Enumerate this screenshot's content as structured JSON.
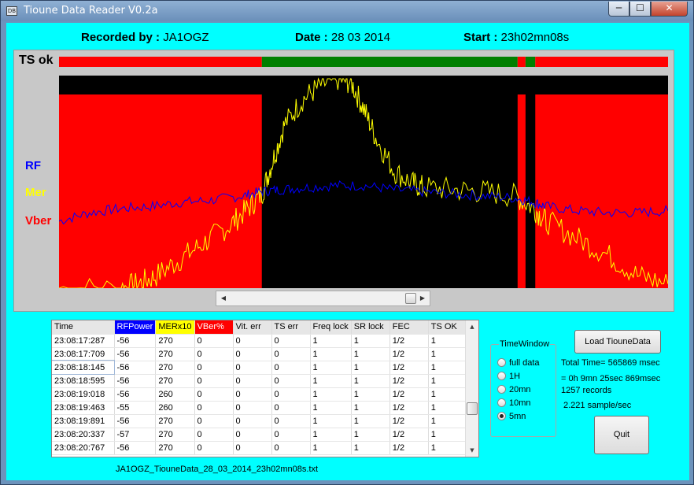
{
  "window": {
    "title": "Tioune Data Reader V0.2a",
    "min": "─",
    "max": "☐",
    "close": "✕",
    "app_icon": "DB"
  },
  "header": {
    "recorded_label": "Recorded by :",
    "recorded_value": "JA1OGZ",
    "date_label": "Date :",
    "date_value": "28 03 2014",
    "start_label": "Start :",
    "start_value": "23h02mn08s"
  },
  "chart": {
    "ts_label": "TS ok",
    "rf_label": "RF",
    "mer_label": "Mer",
    "vber_label": "Vber",
    "colors": {
      "rf": "#0000ff",
      "mer": "#ffff00",
      "vber": "#ff0000",
      "ts_ok": "#008000",
      "ts_bad": "#ff0000",
      "bg": "#000000"
    }
  },
  "chart_data": {
    "type": "line",
    "title": "",
    "x_range": [
      0,
      1
    ],
    "ts_segments": [
      [
        0,
        0.333,
        "bad"
      ],
      [
        0.333,
        0.753,
        "ok"
      ],
      [
        0.753,
        0.766,
        "bad"
      ],
      [
        0.766,
        0.782,
        "ok"
      ],
      [
        0.782,
        1.0,
        "bad"
      ]
    ],
    "vber_segments": [
      [
        0,
        0.333
      ],
      [
        0.753,
        0.766
      ],
      [
        0.782,
        1.0
      ]
    ],
    "series": [
      {
        "name": "RF",
        "x": [
          0,
          0.05,
          0.1,
          0.15,
          0.2,
          0.25,
          0.3,
          0.33,
          0.36,
          0.4,
          0.45,
          0.5,
          0.55,
          0.6,
          0.65,
          0.7,
          0.75,
          0.78,
          0.8,
          0.85,
          0.9,
          0.95,
          1.0
        ],
        "y": [
          0.32,
          0.36,
          0.38,
          0.39,
          0.41,
          0.42,
          0.44,
          0.46,
          0.47,
          0.48,
          0.49,
          0.49,
          0.47,
          0.46,
          0.45,
          0.44,
          0.43,
          0.41,
          0.39,
          0.37,
          0.36,
          0.36,
          0.37
        ]
      },
      {
        "name": "Mer",
        "x": [
          0,
          0.1,
          0.13,
          0.16,
          0.2,
          0.24,
          0.28,
          0.31,
          0.333,
          0.35,
          0.37,
          0.4,
          0.43,
          0.46,
          0.48,
          0.5,
          0.52,
          0.55,
          0.58,
          0.6,
          0.65,
          0.7,
          0.75,
          0.78,
          0.8,
          0.85,
          0.9,
          0.95,
          1.0
        ],
        "y": [
          0.0,
          0.0,
          0.02,
          0.06,
          0.14,
          0.22,
          0.3,
          0.38,
          0.45,
          0.6,
          0.78,
          0.9,
          0.97,
          1.0,
          0.98,
          0.86,
          0.72,
          0.56,
          0.5,
          0.48,
          0.47,
          0.46,
          0.44,
          0.38,
          0.32,
          0.24,
          0.16,
          0.06,
          0.02
        ]
      }
    ]
  },
  "grid": {
    "columns": [
      "Time",
      "RFPower",
      "MERx10",
      "VBer%",
      "Vit. err",
      "TS err",
      "Freq lock",
      "SR lock",
      "FEC",
      "TS OK"
    ],
    "rows": [
      [
        "23:08:17:287",
        "-56",
        "270",
        "0",
        "0",
        "0",
        "1",
        "1",
        "1/2",
        "1"
      ],
      [
        "23:08:17:709",
        "-56",
        "270",
        "0",
        "0",
        "0",
        "1",
        "1",
        "1/2",
        "1"
      ],
      [
        "23:08:18:145",
        "-56",
        "270",
        "0",
        "0",
        "0",
        "1",
        "1",
        "1/2",
        "1"
      ],
      [
        "23:08:18:595",
        "-56",
        "270",
        "0",
        "0",
        "0",
        "1",
        "1",
        "1/2",
        "1"
      ],
      [
        "23:08:19:018",
        "-56",
        "260",
        "0",
        "0",
        "0",
        "1",
        "1",
        "1/2",
        "1"
      ],
      [
        "23:08:19:463",
        "-55",
        "260",
        "0",
        "0",
        "0",
        "1",
        "1",
        "1/2",
        "1"
      ],
      [
        "23:08:19:891",
        "-56",
        "270",
        "0",
        "0",
        "0",
        "1",
        "1",
        "1/2",
        "1"
      ],
      [
        "23:08:20:337",
        "-57",
        "270",
        "0",
        "0",
        "0",
        "1",
        "1",
        "1/2",
        "1"
      ],
      [
        "23:08:20:767",
        "-56",
        "270",
        "0",
        "0",
        "0",
        "1",
        "1",
        "1/2",
        "1"
      ]
    ]
  },
  "filename": "JA1OGZ_TiouneData_28_03_2014_23h02mn08s.txt",
  "time_window": {
    "title": "TimeWindow",
    "options": [
      "full data",
      "1H",
      "20mn",
      "10mn",
      "5mn"
    ],
    "selected": "5mn"
  },
  "actions": {
    "load_label": "Load TiouneData",
    "quit_label": "Quit"
  },
  "stats": {
    "total_time": "Total Time= 565869 msec",
    "duration": "= 0h 9mn 25sec 869msec",
    "records": "1257 records",
    "rate": "2.221 sample/sec"
  }
}
